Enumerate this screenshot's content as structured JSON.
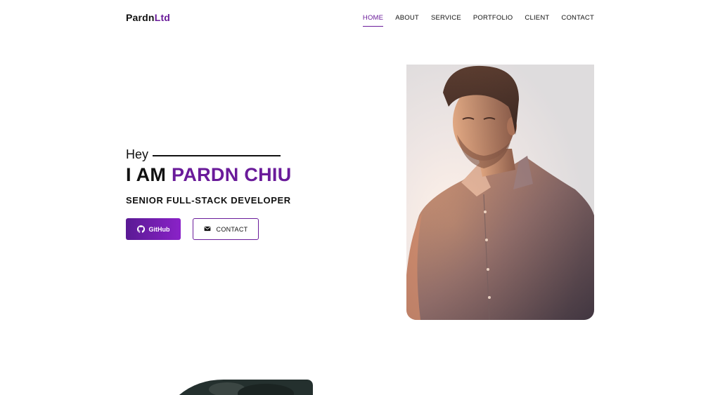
{
  "brand": {
    "name_main": "Pardn",
    "name_accent": "Ltd"
  },
  "nav": {
    "items": [
      {
        "label": "HOME",
        "active": true
      },
      {
        "label": "ABOUT",
        "active": false
      },
      {
        "label": "SERVICE",
        "active": false
      },
      {
        "label": "PORTFOLIO",
        "active": false
      },
      {
        "label": "CLIENT",
        "active": false
      },
      {
        "label": "CONTACT",
        "active": false
      }
    ]
  },
  "hero": {
    "greeting": "Hey",
    "headline_prefix": "I AM",
    "headline_name": "PARDN CHIU",
    "role": "SENIOR FULL-STACK DEVELOPER",
    "github_label": "GitHub",
    "github_icon": "github-icon",
    "contact_label": "CONTACT",
    "contact_icon": "envelope-icon"
  },
  "colors": {
    "accent": "#6a1b9a",
    "accent_gradient_end": "#8a22c8",
    "text": "#111111",
    "background": "#ffffff"
  }
}
